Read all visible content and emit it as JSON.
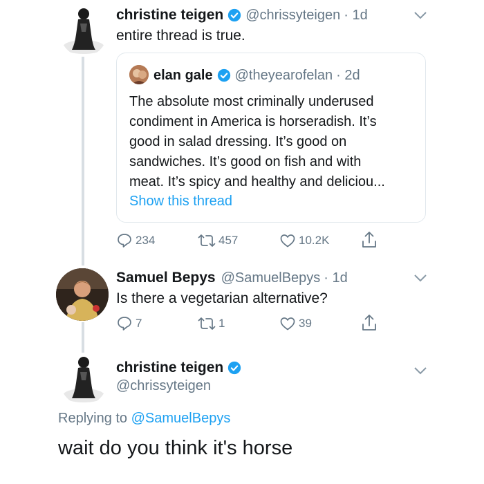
{
  "tweet1": {
    "name": "christine teigen",
    "handle": "@chrissyteigen",
    "time": "· 1d",
    "text": "entire thread is true."
  },
  "quote": {
    "name": "elan gale",
    "handle": "@theyearofelan",
    "time": "· 2d",
    "lines": [
      "The absolute most criminally underused",
      "condiment in America is horseradish. It’s",
      "good in salad dressing. It’s good on",
      "sandwiches. It’s good on fish and with",
      "meat. It’s spicy and healthy and deliciou..."
    ],
    "show_thread": "Show this thread"
  },
  "tweet1_actions": {
    "replies": "234",
    "retweets": "457",
    "likes": "10.2K"
  },
  "tweet2": {
    "name": "Samuel Bepys",
    "handle": "@SamuelBepys",
    "time": "· 1d",
    "text": "Is there a vegetarian alternative?"
  },
  "tweet2_actions": {
    "replies": "7",
    "retweets": "1",
    "likes": "39"
  },
  "tweet3": {
    "name": "christine teigen",
    "handle": "@chrissyteigen",
    "replying_prefix": "Replying to ",
    "replying_handle": "@SamuelBepys",
    "text": "wait do you think it's horse"
  },
  "colors": {
    "accent": "#1da1f2",
    "secondary": "#657786",
    "text": "#14171a",
    "line": "#d8dee3"
  },
  "icons": [
    "verified-badge-icon",
    "chevron-down-icon",
    "reply-icon",
    "retweet-icon",
    "like-icon",
    "share-icon"
  ]
}
